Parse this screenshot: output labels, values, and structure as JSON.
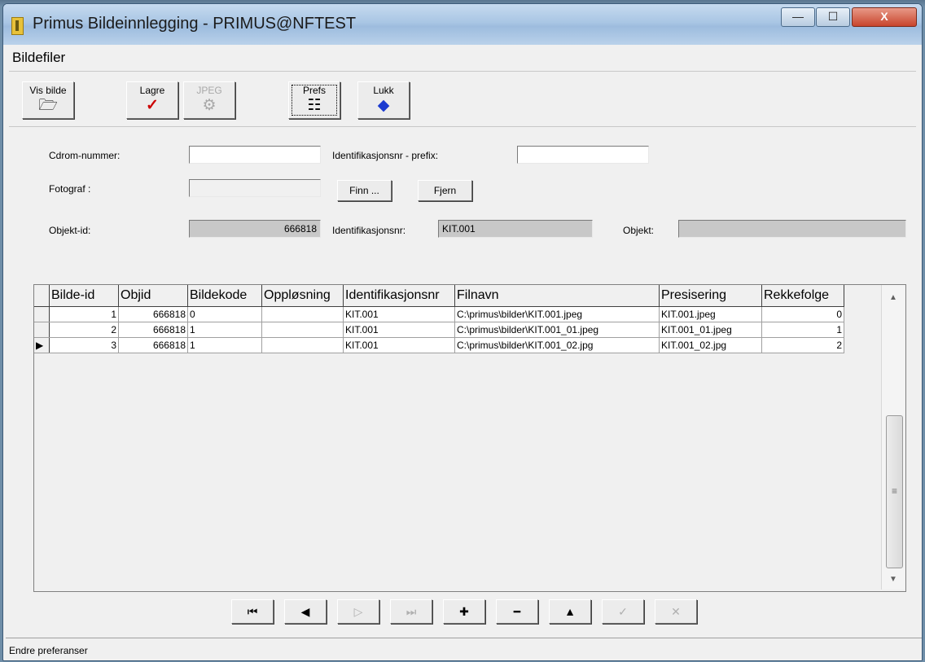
{
  "window": {
    "title": "Primus Bildeinnlegging - PRIMUS@NFTEST"
  },
  "caption_buttons": {
    "minimize": "—",
    "maximize": "☐",
    "close": "X"
  },
  "menu": {
    "title": "Bildefiler"
  },
  "toolbar": {
    "vis_bilde": {
      "label": "Vis bilde",
      "icon": "folder-open-icon",
      "glyph": "🗁"
    },
    "lagre": {
      "label": "Lagre",
      "icon": "checkmark-icon",
      "glyph": "✓",
      "color": "#cc0000"
    },
    "jpeg": {
      "label": "JPEG",
      "icon": "jpeg-convert-icon",
      "glyph": "⚙"
    },
    "prefs": {
      "label": "Prefs",
      "icon": "preferences-tree-icon",
      "glyph": "☷"
    },
    "lukk": {
      "label": "Lukk",
      "icon": "blue-book-icon",
      "glyph": "◆",
      "color": "#1a3ad0"
    }
  },
  "form": {
    "cdrom_label": "Cdrom-nummer:",
    "cdrom_value": "",
    "prefix_label": "Identifikasjonsnr - prefix:",
    "prefix_value": "",
    "fotograf_label": "Fotograf :",
    "fotograf_value": "",
    "finn_label": "Finn ...",
    "fjern_label": "Fjern",
    "objektid_label": "Objekt-id:",
    "objektid_value": "666818",
    "identnr_label": "Identifikasjonsnr:",
    "identnr_value": "KIT.001",
    "objekt_label": "Objekt:",
    "objekt_value": ""
  },
  "grid": {
    "columns": [
      "Bilde-id",
      "Objid",
      "Bildekode",
      "Oppløsning",
      "Identifikasjonsnr",
      "Filnavn",
      "Presisering",
      "Rekkefolge"
    ],
    "rows": [
      {
        "indicator": "",
        "bilde_id": "1",
        "objid": "666818",
        "bildekode": "0",
        "opplosning": "",
        "identnr": "KIT.001",
        "filnavn": "C:\\primus\\bilder\\KIT.001.jpeg",
        "presisering": "KIT.001.jpeg",
        "rekkefolge": "0"
      },
      {
        "indicator": "",
        "bilde_id": "2",
        "objid": "666818",
        "bildekode": "1",
        "opplosning": "",
        "identnr": "KIT.001",
        "filnavn": "C:\\primus\\bilder\\KIT.001_01.jpeg",
        "presisering": "KIT.001_01.jpeg",
        "rekkefolge": "1"
      },
      {
        "indicator": "▶",
        "bilde_id": "3",
        "objid": "666818",
        "bildekode": "1",
        "opplosning": "",
        "identnr": "KIT.001",
        "filnavn": "C:\\primus\\bilder\\KIT.001_02.jpg",
        "presisering": "KIT.001_02.jpg",
        "rekkefolge": "2"
      }
    ],
    "scroll": {
      "up": "▲",
      "down": "▼",
      "grip": "≡"
    }
  },
  "navigator": {
    "first": "⏮",
    "prior": "◀",
    "next": "▷",
    "last": "⏭",
    "insert": "✚",
    "delete": "━",
    "edit": "▲",
    "post": "✓",
    "cancel": "✕"
  },
  "status": {
    "text": "Endre preferanser"
  }
}
